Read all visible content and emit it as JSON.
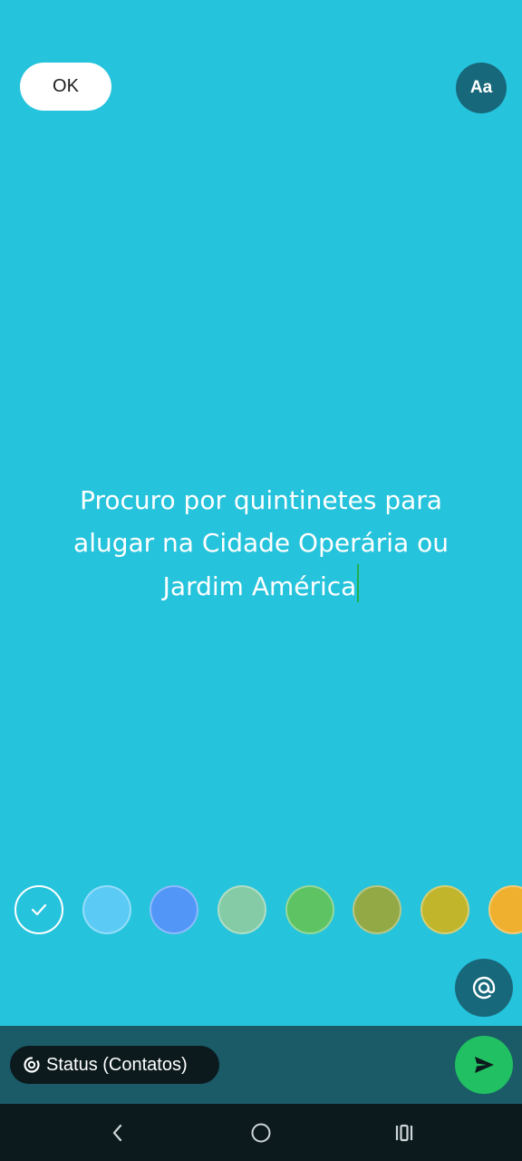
{
  "toolbar": {
    "ok_label": "OK",
    "font_label": "Aa"
  },
  "status": {
    "line1": "Procuro por quintinetes para",
    "line2": "alugar na Cidade Operária ou",
    "line3": "Jardim América"
  },
  "palette": {
    "selected_color": "#26C3DC",
    "colors": [
      "#5BCBF6",
      "#5296F8",
      "#85CCA6",
      "#5DC363",
      "#93A946",
      "#C0B52B",
      "#EEB02E"
    ]
  },
  "composer": {
    "audience_label": "Status (Contatos)"
  },
  "icons": {
    "selected": "checkmark-icon",
    "mention": "at-sign-icon",
    "audience": "privacy-icon",
    "send": "send-icon",
    "back": "back-icon",
    "home": "home-icon",
    "recents": "recents-icon"
  },
  "theme": {
    "background": "#26C3DC",
    "dark_teal": "#17687A",
    "bottom_bar": "#1B5A67",
    "send_green": "#21C063",
    "nav_bar": "#0C1A1E"
  }
}
